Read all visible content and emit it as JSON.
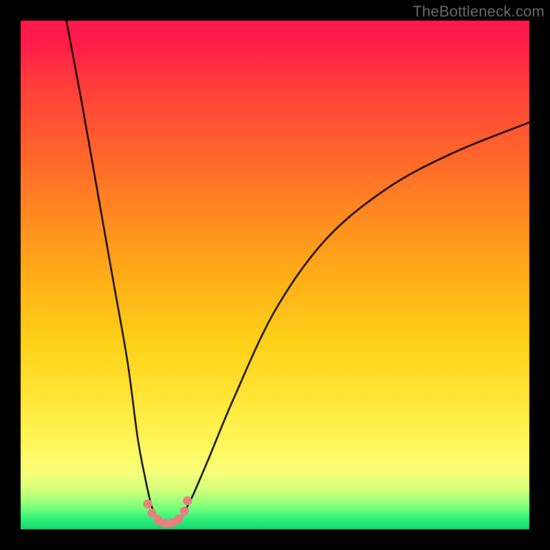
{
  "watermark": "TheBottleneck.com",
  "chart_data": {
    "type": "line",
    "title": "",
    "xlabel": "",
    "ylabel": "",
    "xlim": [
      0,
      100
    ],
    "ylim": [
      0,
      100
    ],
    "series": [
      {
        "name": "left-branch",
        "x": [
          9,
          12,
          15,
          18,
          21,
          23,
          24.5,
          25.5,
          26.2,
          26.8
        ],
        "y": [
          100,
          84,
          67,
          50,
          33,
          18,
          10,
          5.5,
          3.2,
          2.4
        ]
      },
      {
        "name": "right-branch",
        "x": [
          31.5,
          32.3,
          34,
          37,
          42,
          50,
          60,
          72,
          85,
          100
        ],
        "y": [
          2.4,
          3.6,
          7,
          14,
          26,
          43,
          57,
          67,
          74,
          80
        ]
      },
      {
        "name": "bottom-arc",
        "x": [
          26.8,
          27.5,
          28.5,
          29.5,
          30.5,
          31.5
        ],
        "y": [
          2.4,
          1.4,
          1.0,
          1.0,
          1.4,
          2.4
        ]
      }
    ],
    "markers": {
      "name": "bottom-dots",
      "color": "#e77f7f",
      "points": [
        {
          "x": 25.0,
          "y": 5.0
        },
        {
          "x": 25.8,
          "y": 3.2
        },
        {
          "x": 27.0,
          "y": 1.8
        },
        {
          "x": 28.4,
          "y": 1.2
        },
        {
          "x": 29.8,
          "y": 1.3
        },
        {
          "x": 31.0,
          "y": 2.0
        },
        {
          "x": 32.2,
          "y": 3.6
        },
        {
          "x": 32.8,
          "y": 5.6
        }
      ]
    },
    "axes_visible": false,
    "grid": false,
    "legend": false
  }
}
